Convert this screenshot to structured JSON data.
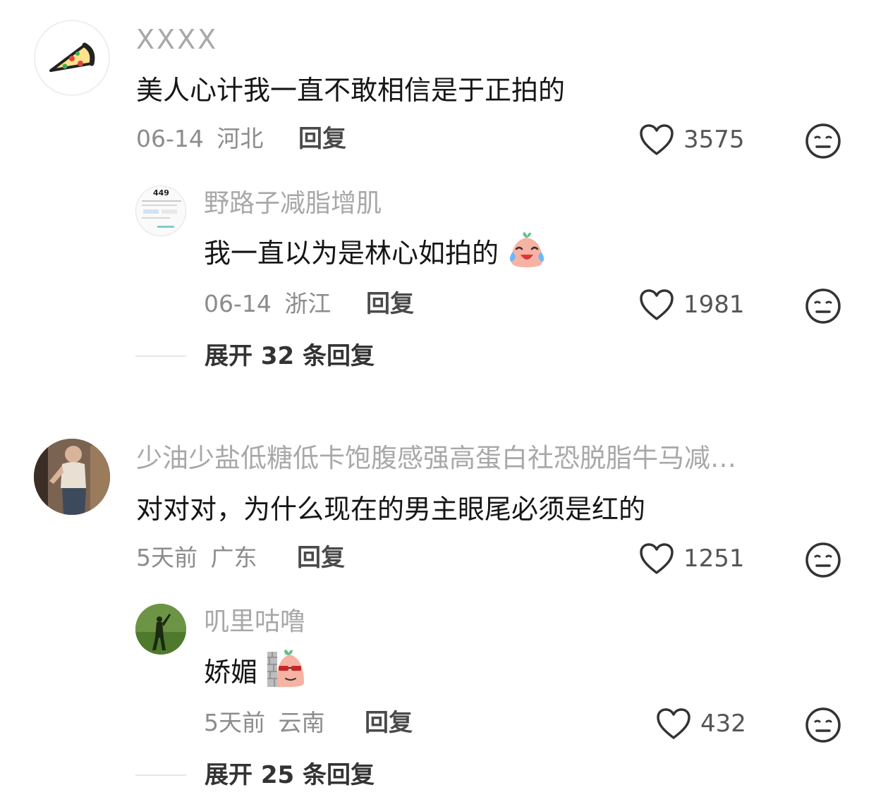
{
  "comments": [
    {
      "username": "XXXX",
      "text": "美人心计我一直不敢相信是于正拍的",
      "date": "06-14",
      "location": "河北",
      "reply_label": "回复",
      "likes": "3575",
      "avatar": "pizza-avatar",
      "replies": [
        {
          "username": "野路子减脂增肌",
          "text": "我一直以为是林心如拍的",
          "emoji": "crying-laughing-emoji",
          "date": "06-14",
          "location": "浙江",
          "reply_label": "回复",
          "likes": "1981",
          "avatar_text": "449"
        }
      ],
      "expand_label": "展开 32 条回复"
    },
    {
      "username": "少油少盐低糖低卡饱腹感强高蛋白社恐脱脂牛马减…",
      "text": "对对对，为什么现在的男主眼尾必须是红的",
      "date": "5天前",
      "location": "广东",
      "reply_label": "回复",
      "likes": "1251",
      "avatar": "photo-avatar",
      "replies": [
        {
          "username": "叽里咕噜",
          "text": "娇媚",
          "emoji": "peeking-wall-emoji",
          "date": "5天前",
          "location": "云南",
          "reply_label": "回复",
          "likes": "432",
          "avatar": "grass-shadow-avatar"
        }
      ],
      "expand_label": "展开 25 条回复"
    }
  ]
}
